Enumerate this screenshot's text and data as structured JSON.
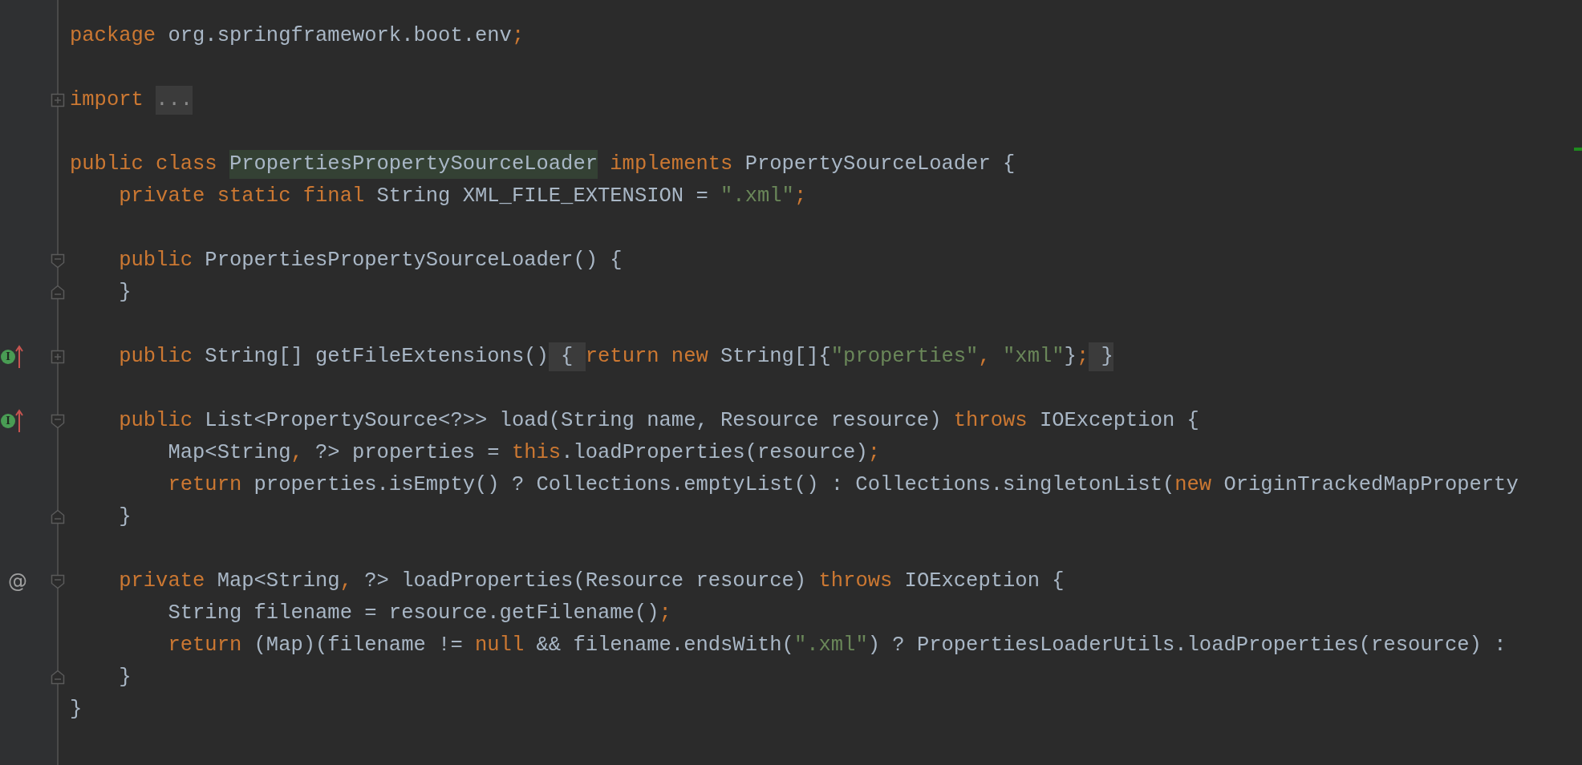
{
  "editor": {
    "lines": [
      {
        "kind": "code",
        "tokens": [
          {
            "kind": "keyword",
            "text": "package"
          },
          {
            "kind": "plain",
            "text": " org.springframework.boot.env"
          },
          {
            "kind": "keyword",
            "text": ";"
          }
        ]
      },
      {
        "kind": "blank"
      },
      {
        "kind": "code",
        "fold": {
          "kind": "collapsed"
        },
        "tokens": [
          {
            "kind": "keyword",
            "text": "import "
          },
          {
            "kind": "fold-dim",
            "text": "..."
          }
        ]
      },
      {
        "kind": "blank"
      },
      {
        "kind": "code",
        "tokens": [
          {
            "kind": "keyword",
            "text": "public class "
          },
          {
            "kind": "usage-highlight",
            "text": "PropertiesPropertySourceLoader"
          },
          {
            "kind": "keyword",
            "text": " implements "
          },
          {
            "kind": "plain",
            "text": "PropertySourceLoader {"
          }
        ]
      },
      {
        "kind": "code",
        "tokens": [
          {
            "kind": "keyword",
            "text": "    private static final "
          },
          {
            "kind": "plain",
            "text": "String XML_FILE_EXTENSION = "
          },
          {
            "kind": "string",
            "text": "\".xml\""
          },
          {
            "kind": "keyword",
            "text": ";"
          }
        ]
      },
      {
        "kind": "blank"
      },
      {
        "kind": "code",
        "fold": {
          "kind": "start"
        },
        "tokens": [
          {
            "kind": "keyword",
            "text": "    public "
          },
          {
            "kind": "plain",
            "text": "PropertiesPropertySourceLoader() {"
          }
        ]
      },
      {
        "kind": "code",
        "fold": {
          "kind": "end"
        },
        "tokens": [
          {
            "kind": "plain",
            "text": "    }"
          }
        ]
      },
      {
        "kind": "blank"
      },
      {
        "kind": "code",
        "fold": {
          "kind": "collapsed"
        },
        "gutter_mark": {
          "kind": "implements",
          "glyph": "I"
        },
        "tokens": [
          {
            "kind": "keyword",
            "text": "    public "
          },
          {
            "kind": "plain",
            "text": "String[] getFileExtensions()"
          },
          {
            "kind": "fold-plain",
            "text": " { "
          },
          {
            "kind": "keyword",
            "text": "return new "
          },
          {
            "kind": "plain",
            "text": "String[]{"
          },
          {
            "kind": "string",
            "text": "\"properties\""
          },
          {
            "kind": "keyword",
            "text": ", "
          },
          {
            "kind": "string",
            "text": "\"xml\""
          },
          {
            "kind": "plain",
            "text": "}"
          },
          {
            "kind": "keyword",
            "text": ";"
          },
          {
            "kind": "fold-plain",
            "text": " }"
          }
        ]
      },
      {
        "kind": "blank"
      },
      {
        "kind": "code",
        "fold": {
          "kind": "start"
        },
        "gutter_mark": {
          "kind": "implements",
          "glyph": "I"
        },
        "tokens": [
          {
            "kind": "keyword",
            "text": "    public "
          },
          {
            "kind": "plain",
            "text": "List<PropertySource<?>> load(String name, Resource resource) "
          },
          {
            "kind": "keyword",
            "text": "throws "
          },
          {
            "kind": "plain",
            "text": "IOException {"
          }
        ]
      },
      {
        "kind": "code",
        "tokens": [
          {
            "kind": "plain",
            "text": "        Map<String"
          },
          {
            "kind": "keyword",
            "text": ", "
          },
          {
            "kind": "plain",
            "text": "?> properties = "
          },
          {
            "kind": "keyword",
            "text": "this"
          },
          {
            "kind": "plain",
            "text": ".loadProperties(resource)"
          },
          {
            "kind": "keyword",
            "text": ";"
          }
        ]
      },
      {
        "kind": "code",
        "tokens": [
          {
            "kind": "keyword",
            "text": "        return "
          },
          {
            "kind": "plain",
            "text": "properties.isEmpty() ? Collections.emptyList() : Collections.singletonList("
          },
          {
            "kind": "keyword",
            "text": "new "
          },
          {
            "kind": "plain",
            "text": "OriginTrackedMapProperty"
          }
        ]
      },
      {
        "kind": "code",
        "fold": {
          "kind": "end"
        },
        "tokens": [
          {
            "kind": "plain",
            "text": "    }"
          }
        ]
      },
      {
        "kind": "blank"
      },
      {
        "kind": "code",
        "fold": {
          "kind": "start"
        },
        "gutter_mark": {
          "kind": "annotation",
          "glyph": "@"
        },
        "tokens": [
          {
            "kind": "keyword",
            "text": "    private "
          },
          {
            "kind": "plain",
            "text": "Map<String"
          },
          {
            "kind": "keyword",
            "text": ", "
          },
          {
            "kind": "plain",
            "text": "?> loadProperties(Resource resource) "
          },
          {
            "kind": "keyword",
            "text": "throws "
          },
          {
            "kind": "plain",
            "text": "IOException {"
          }
        ]
      },
      {
        "kind": "code",
        "tokens": [
          {
            "kind": "plain",
            "text": "        String filename = resource.getFilename()"
          },
          {
            "kind": "keyword",
            "text": ";"
          }
        ]
      },
      {
        "kind": "code",
        "tokens": [
          {
            "kind": "keyword",
            "text": "        return "
          },
          {
            "kind": "plain",
            "text": "(Map)(filename != "
          },
          {
            "kind": "keyword",
            "text": "null "
          },
          {
            "kind": "plain",
            "text": "&& filename.endsWith("
          },
          {
            "kind": "string",
            "text": "\".xml\""
          },
          {
            "kind": "plain",
            "text": ") ? PropertiesLoaderUtils.loadProperties(resource) :"
          }
        ]
      },
      {
        "kind": "code",
        "fold": {
          "kind": "end"
        },
        "tokens": [
          {
            "kind": "plain",
            "text": "    }"
          }
        ]
      },
      {
        "kind": "code",
        "tokens": [
          {
            "kind": "plain",
            "text": "}"
          }
        ]
      }
    ]
  }
}
